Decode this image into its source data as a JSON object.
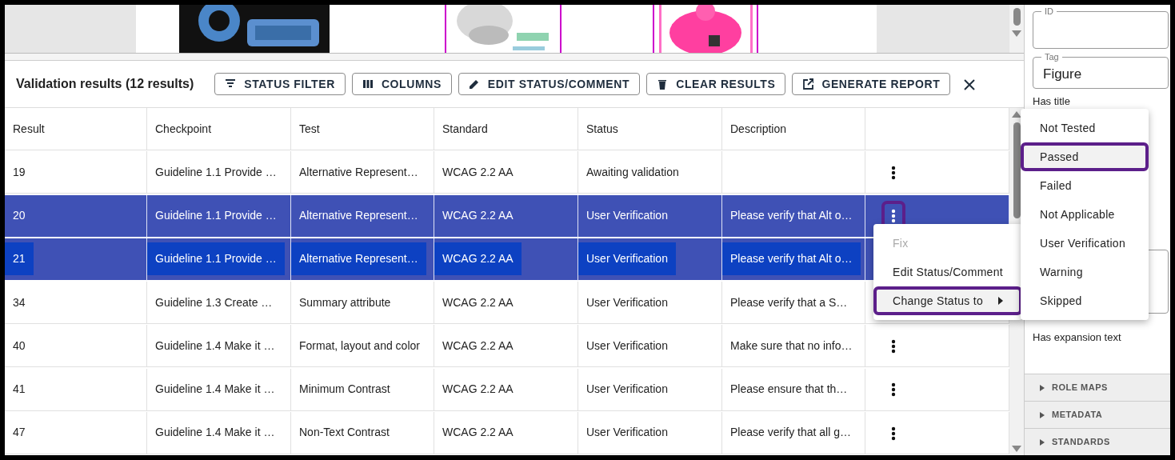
{
  "results_panel": {
    "title": "Validation results (12 results)",
    "toolbar": [
      {
        "kind": "filter",
        "label": "STATUS FILTER"
      },
      {
        "kind": "columns",
        "label": "COLUMNS"
      },
      {
        "kind": "edit",
        "label": "EDIT STATUS/COMMENT"
      },
      {
        "kind": "clear",
        "label": "CLEAR RESULTS"
      },
      {
        "kind": "report",
        "label": "GENERATE REPORT"
      },
      {
        "kind": "close"
      }
    ],
    "table": {
      "columns": [
        "Result",
        "Checkpoint",
        "Test",
        "Standard",
        "Status",
        "Description"
      ],
      "rows": [
        {
          "cells": [
            "19",
            "Guideline 1.1 Provide …",
            "Alternative Represent…",
            "WCAG 2.2 AA",
            "Awaiting validation",
            ""
          ],
          "selected": false,
          "text_highlighted": false,
          "menu_focused": false
        },
        {
          "cells": [
            "20",
            "Guideline 1.1 Provide …",
            "Alternative Represent…",
            "WCAG 2.2 AA",
            "User Verification",
            "Please verify that Alt o…"
          ],
          "selected": true,
          "text_highlighted": false,
          "menu_focused": true
        },
        {
          "cells": [
            "21",
            "Guideline 1.1 Provide …",
            "Alternative Represent…",
            "WCAG 2.2 AA",
            "User Verification",
            "Please verify that Alt o…"
          ],
          "selected": true,
          "text_highlighted": true
        },
        {
          "cells": [
            "34",
            "Guideline 1.3 Create …",
            "Summary attribute",
            "WCAG 2.2 AA",
            "User Verification",
            "Please verify that a S…"
          ],
          "selected": false,
          "text_highlighted": false
        },
        {
          "cells": [
            "40",
            "Guideline 1.4 Make it …",
            "Format, layout and color",
            "WCAG 2.2 AA",
            "User Verification",
            "Make sure that no info…"
          ],
          "selected": false,
          "text_highlighted": false,
          "menu_focused": false
        },
        {
          "cells": [
            "41",
            "Guideline 1.4 Make it …",
            "Minimum Contrast",
            "WCAG 2.2 AA",
            "User Verification",
            "Please ensure that th…"
          ],
          "selected": false,
          "text_highlighted": false,
          "menu_focused": false
        },
        {
          "cells": [
            "47",
            "Guideline 1.4 Make it …",
            "Non-Text Contrast",
            "WCAG 2.2 AA",
            "User Verification",
            "Please verify that all g…"
          ],
          "selected": false,
          "text_highlighted": false,
          "menu_focused": false
        }
      ]
    }
  },
  "context_menu": {
    "items": [
      {
        "label": "Fix",
        "disabled": true,
        "focused": false,
        "submenu": false
      },
      {
        "label": "Edit Status/Comment",
        "disabled": false,
        "focused": false,
        "submenu": false
      },
      {
        "label": "Change Status to",
        "disabled": false,
        "focused": true,
        "submenu": true
      }
    ]
  },
  "status_submenu": {
    "items": [
      {
        "label": "Not Tested",
        "focused": false
      },
      {
        "label": "Passed",
        "focused": true
      },
      {
        "label": "Failed",
        "focused": false
      },
      {
        "label": "Not Applicable",
        "focused": false
      },
      {
        "label": "User Verification",
        "focused": false
      },
      {
        "label": "Warning",
        "focused": false
      },
      {
        "label": "Skipped",
        "focused": false
      }
    ]
  },
  "properties_panel": {
    "fields": [
      {
        "label": "ID"
      },
      {
        "label": "Tag",
        "value": "Figure"
      }
    ],
    "labels": [
      "Has title",
      "Has expansion text"
    ],
    "sections": [
      {
        "label": "ROLE MAPS",
        "expanded": false
      },
      {
        "label": "METADATA",
        "expanded": false
      },
      {
        "label": "STANDARDS",
        "expanded": false
      }
    ]
  }
}
